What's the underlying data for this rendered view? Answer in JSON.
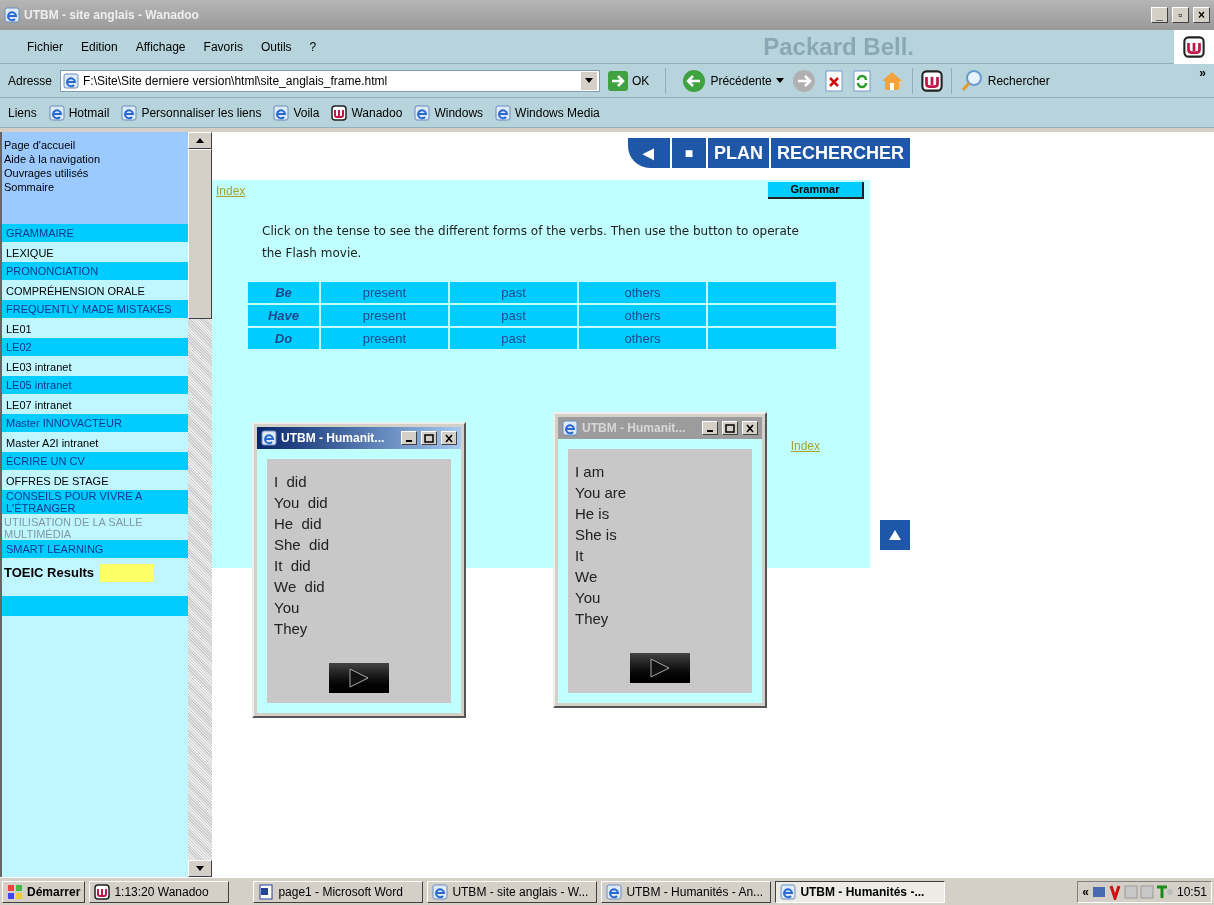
{
  "window": {
    "title": "UTBM - site anglais - Wanadoo",
    "controls": [
      "_",
      "▫",
      "×"
    ]
  },
  "menu": [
    "Fichier",
    "Edition",
    "Affichage",
    "Favoris",
    "Outils",
    "?"
  ],
  "brand": "Packard Bell.",
  "address": {
    "label": "Adresse",
    "value": "F:\\Site\\Site derniere version\\html\\site_anglais_frame.html",
    "go": "OK"
  },
  "toolbar": {
    "back": "Précédente",
    "search": "Rechercher",
    "more": "»"
  },
  "links": {
    "label": "Liens",
    "items": [
      {
        "label": "Hotmail",
        "kind": "ie"
      },
      {
        "label": "Personnaliser les liens",
        "kind": "ie"
      },
      {
        "label": "Voila",
        "kind": "ie"
      },
      {
        "label": "Wanadoo",
        "kind": "w"
      },
      {
        "label": "Windows",
        "kind": "ie"
      },
      {
        "label": "Windows Media",
        "kind": "ie"
      }
    ]
  },
  "sidebar": {
    "top_links": [
      "Page d'accueil",
      "Aide à la navigation",
      "Ouvrages utilisés",
      "Sommaire"
    ],
    "items": [
      {
        "label": "GRAMMAIRE",
        "kind": "section"
      },
      {
        "label": "LEXIQUE",
        "kind": "link"
      },
      {
        "label": "PRONONCIATION",
        "kind": "section"
      },
      {
        "label": "COMPRÉHENSION ORALE",
        "kind": "link"
      },
      {
        "label": "FREQUENTLY MADE MISTAKES",
        "kind": "section"
      },
      {
        "label": "LE01",
        "kind": "link"
      },
      {
        "label": "LE02",
        "kind": "section"
      },
      {
        "label": "LE03 intranet",
        "kind": "link"
      },
      {
        "label": "LE05 intranet",
        "kind": "section"
      },
      {
        "label": "LE07 intranet",
        "kind": "link"
      },
      {
        "label": "Master INNOVACTEUR",
        "kind": "section"
      },
      {
        "label": "Master A2I intranet",
        "kind": "link"
      },
      {
        "label": "ÉCRIRE UN CV",
        "kind": "section"
      },
      {
        "label": "OFFRES DE STAGE",
        "kind": "link"
      },
      {
        "label": "CONSEILS POUR VIVRE A L'ÉTRANGER",
        "kind": "section"
      },
      {
        "label": "UTILISATION DE LA SALLE MULTIMÉDIA",
        "kind": "disabled"
      },
      {
        "label": "SMART LEARNING",
        "kind": "section"
      },
      {
        "label": "TOEIC Results",
        "kind": "highlight"
      }
    ]
  },
  "nav": [
    {
      "label": "◀",
      "kind": "icon"
    },
    {
      "label": "■",
      "kind": "icon"
    },
    {
      "label": "PLAN",
      "kind": "text"
    },
    {
      "label": "RECHERCHER",
      "kind": "text"
    }
  ],
  "page": {
    "index_top": "Index",
    "grammar": "Grammar",
    "instructions": "Click on the tense to see the different forms of the verbs. Then use the button to operate the Flash movie.",
    "index_right": "Index",
    "table": [
      [
        "Be",
        "present",
        "past",
        "others"
      ],
      [
        "Have",
        "present",
        "past",
        "others"
      ],
      [
        "Do",
        "present",
        "past",
        "others"
      ]
    ]
  },
  "popups": [
    {
      "title": "UTBM - Humanit...",
      "active": true,
      "lines": [
        "I  did",
        "You  did",
        "He  did",
        "She  did",
        "It  did",
        "We  did",
        "You",
        "They"
      ]
    },
    {
      "title": "UTBM - Humanit...",
      "active": false,
      "lines": [
        "I am",
        "You are",
        "He is",
        "She is",
        "It",
        "We",
        "You",
        "They"
      ]
    }
  ],
  "taskbar": {
    "start": "Démarrer",
    "buttons": [
      {
        "label": "1:13:20 Wanadoo",
        "kind": "w",
        "selected": false
      },
      {
        "label": "page1 - Microsoft Word",
        "kind": "word",
        "selected": false
      },
      {
        "label": "UTBM - site anglais - W...",
        "kind": "ie",
        "selected": false
      },
      {
        "label": "UTBM - Humanités - An...",
        "kind": "ie",
        "selected": false
      },
      {
        "label": "UTBM - Humanités -...",
        "kind": "ie",
        "selected": true
      }
    ],
    "tray_more": "«",
    "clock": "10:51"
  }
}
